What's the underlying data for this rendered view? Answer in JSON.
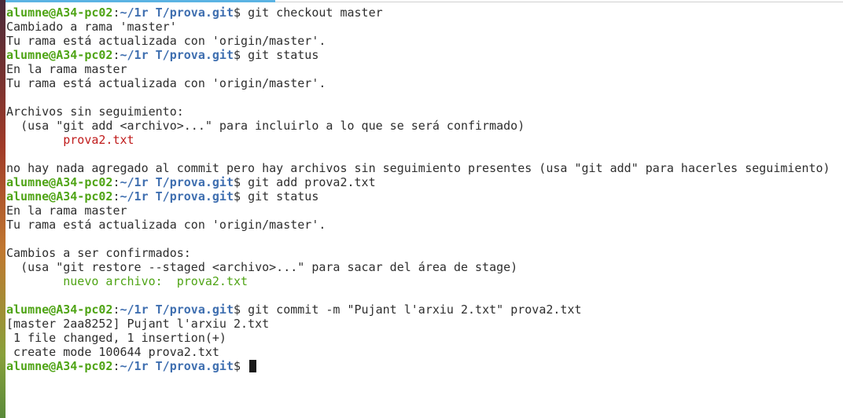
{
  "terminal": {
    "user_host": "alumne@A34-pc02",
    "path": "~/1r T/prova.git",
    "prompt_sep": ":",
    "prompt_char": "$",
    "cmd1": "git checkout master",
    "out1": "Cambiado a rama 'master'",
    "out2": "Tu rama está actualizada con 'origin/master'.",
    "cmd2": "git status",
    "out3": "En la rama master",
    "out4": "Tu rama está actualizada con 'origin/master'.",
    "out5": "Archivos sin seguimiento:",
    "out6": "(usa \"git add <archivo>...\" para incluirlo a lo que se será confirmado)",
    "out7": "prova2.txt",
    "out8": "no hay nada agregado al commit pero hay archivos sin seguimiento presentes (usa \"git add\" para hacerles seguimiento)",
    "cmd3": "git add prova2.txt",
    "cmd4": "git status",
    "out9": "En la rama master",
    "out10": "Tu rama está actualizada con 'origin/master'.",
    "out11": "Cambios a ser confirmados:",
    "out12": "(usa \"git restore --staged <archivo>...\" para sacar del área de stage)",
    "out13_label": "nuevo archivo:",
    "out13_file": "prova2.txt",
    "cmd5": "git commit -m \"Pujant l'arxiu 2.txt\" prova2.txt",
    "out14": "[master 2aa8252] Pujant l'arxiu 2.txt",
    "out15": "1 file changed, 1 insertion(+)",
    "out16": "create mode 100644 prova2.txt"
  },
  "colors": {
    "prompt_user": "#4fa415",
    "prompt_path": "#3f6fb0",
    "untracked": "#c01c1c",
    "staged": "#4fa415"
  }
}
